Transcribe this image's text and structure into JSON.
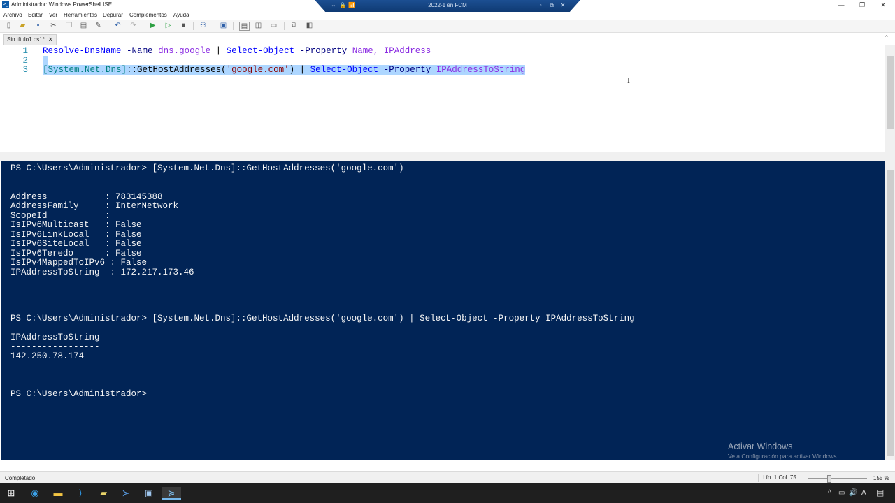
{
  "window": {
    "title": "Administrador: Windows PowerShell ISE",
    "app_icon": ">_",
    "min": "—",
    "max": "❐",
    "close": "✕"
  },
  "remote_bar": {
    "title": "2022-1 en FCM",
    "icons": [
      "⇔",
      "🔒",
      "📶"
    ],
    "min": "▫",
    "max": "⧉",
    "close": "✕"
  },
  "menu": [
    "Archivo",
    "Editar",
    "Ver",
    "Herramientas",
    "Depurar",
    "Complementos",
    "Ayuda"
  ],
  "toolbar_icons": [
    "new-file-icon",
    "open-icon",
    "save-icon",
    "cut-icon",
    "copy-icon",
    "paste-icon",
    "clear-icon",
    "undo-icon",
    "redo-icon",
    "run-icon",
    "run-selection-icon",
    "stop-icon",
    "remote-icon",
    "console-icon",
    "layout-top-icon",
    "layout-right-icon",
    "layout-max-icon",
    "snippets-icon",
    "addons-icon"
  ],
  "tab": {
    "label": "Sin título1.ps1*",
    "close": "✕"
  },
  "editor": {
    "line_numbers": [
      "1",
      "2",
      "3"
    ],
    "line1": {
      "cmd1": "Resolve-DnsName",
      "p1": "-Name",
      "a1": "dns.google",
      "pipe": "|",
      "cmd2": "Select-Object",
      "p2": "-Property",
      "a2": "Name,",
      "a3": "IPAddress"
    },
    "line3": {
      "type": "[System.Net.Dns]",
      "op": "::",
      "method": "GetHostAddresses(",
      "str": "'google.com'",
      "close": ")",
      "pipe": "|",
      "cmd": "Select-Object",
      "param": "-Property",
      "arg": "IPAddressToString"
    }
  },
  "console": {
    "lines": [
      "PS C:\\Users\\Administrador> [System.Net.Dns]::GetHostAddresses('google.com')",
      "",
      "",
      "Address           : 783145388",
      "AddressFamily     : InterNetwork",
      "ScopeId           :",
      "IsIPv6Multicast   : False",
      "IsIPv6LinkLocal   : False",
      "IsIPv6SiteLocal   : False",
      "IsIPv6Teredo      : False",
      "IsIPv4MappedToIPv6 : False",
      "IPAddressToString  : 172.217.173.46",
      "",
      "",
      "",
      "",
      "PS C:\\Users\\Administrador> [System.Net.Dns]::GetHostAddresses('google.com') | Select-Object -Property IPAddressToString",
      "",
      "IPAddressToString",
      "-----------------",
      "142.250.78.174",
      "",
      "",
      "",
      "PS C:\\Users\\Administrador>"
    ]
  },
  "watermark": {
    "title": "Activar Windows",
    "subtitle": "Ve a Configuración para activar Windows."
  },
  "status": {
    "text": "Completado",
    "position": "Lín. 1  Col. 75",
    "zoom": "155 %",
    "zoom_level_percent": 155
  },
  "taskbar": {
    "items": [
      {
        "name": "start-icon",
        "glyph": "⊞"
      },
      {
        "name": "edge-icon",
        "glyph": "◉"
      },
      {
        "name": "explorer-icon",
        "glyph": "▬"
      },
      {
        "name": "vscode-icon",
        "glyph": "⟩"
      },
      {
        "name": "app-icon",
        "glyph": "▰"
      },
      {
        "name": "powershell-icon",
        "glyph": "≻"
      },
      {
        "name": "rdp-icon",
        "glyph": "▣"
      },
      {
        "name": "powershell-ise-icon",
        "glyph": "≽"
      }
    ],
    "tray": [
      "^",
      "▭",
      "🔊",
      "A"
    ],
    "notification": "▤"
  },
  "colors": {
    "console_bg": "#012456",
    "selection": "#add6ff",
    "keyword": "#0000ff",
    "string": "#8b0000",
    "argument": "#8a2be2"
  }
}
